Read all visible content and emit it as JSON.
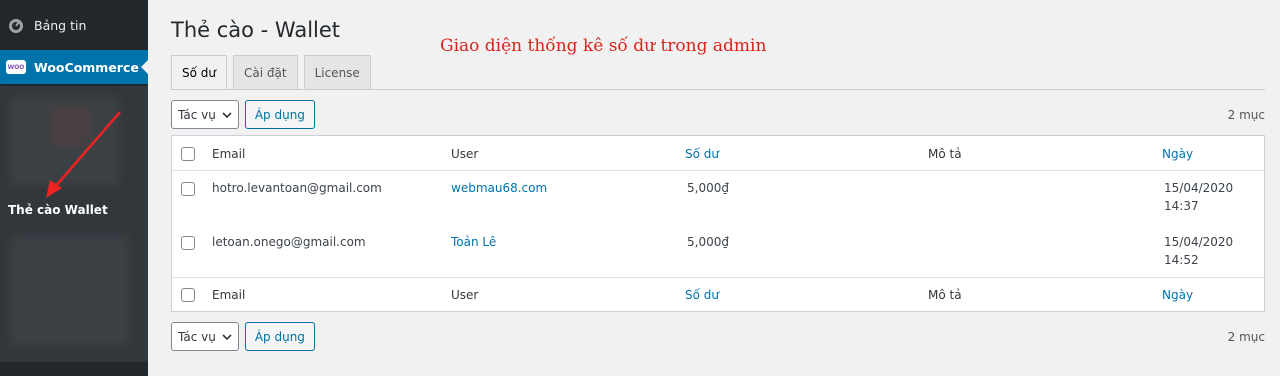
{
  "sidebar": {
    "dashboard_label": "Bảng tin",
    "woocommerce_label": "WooCommerce",
    "woocommerce_badge": "WOO",
    "active_submenu_label": "Thẻ cào Wallet"
  },
  "page": {
    "title": "Thẻ cào - Wallet",
    "annotation": "Giao diện thống kê số dư trong admin"
  },
  "tabs": [
    {
      "label": "Số dư",
      "active": true
    },
    {
      "label": "Cài đặt",
      "active": false
    },
    {
      "label": "License",
      "active": false
    }
  ],
  "bulk_actions": {
    "select_label": "Tác vụ",
    "apply_label": "Áp dụng",
    "item_count": "2 mục"
  },
  "table": {
    "columns": [
      "Email",
      "User",
      "Số dư",
      "Mô tả",
      "Ngày"
    ],
    "rows": [
      {
        "email": "hotro.levantoan@gmail.com",
        "user": "webmau68.com",
        "balance": "5,000₫",
        "description": "",
        "date": "15/04/2020",
        "time": "14:37"
      },
      {
        "email": "letoan.onego@gmail.com",
        "user": "Toản Lê",
        "balance": "5,000₫",
        "description": "",
        "date": "15/04/2020",
        "time": "14:52"
      }
    ]
  },
  "colors": {
    "sidebar_bg": "#23282d",
    "active_menu": "#0073aa",
    "link": "#0073aa",
    "annotation": "#d9241c"
  }
}
